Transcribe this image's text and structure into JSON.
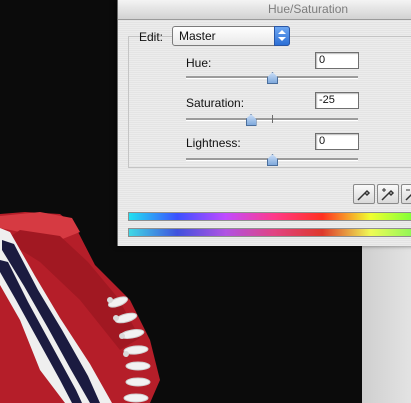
{
  "dialog": {
    "title": "Hue/Saturation",
    "edit": {
      "label": "Edit:",
      "value": "Master"
    },
    "hue": {
      "label": "Hue:",
      "value": "0"
    },
    "saturation": {
      "label": "Saturation:",
      "value": "-25"
    },
    "lightness": {
      "label": "Lightness:",
      "value": "0"
    },
    "eyedroppers": [
      "eyedropper-icon",
      "eyedropper-plus-icon",
      "eyedropper-minus-icon"
    ],
    "bar_colors": [
      "#22e0f0",
      "#3a50ff",
      "#c04bff",
      "#ff3a8a",
      "#ff3020",
      "#f0ff30",
      "#6dff3a"
    ],
    "slider_accent": "#7fa9dc"
  },
  "background": {
    "description": "photo of a red canvas sneaker on black background",
    "shoe_color": "#c0242e"
  }
}
